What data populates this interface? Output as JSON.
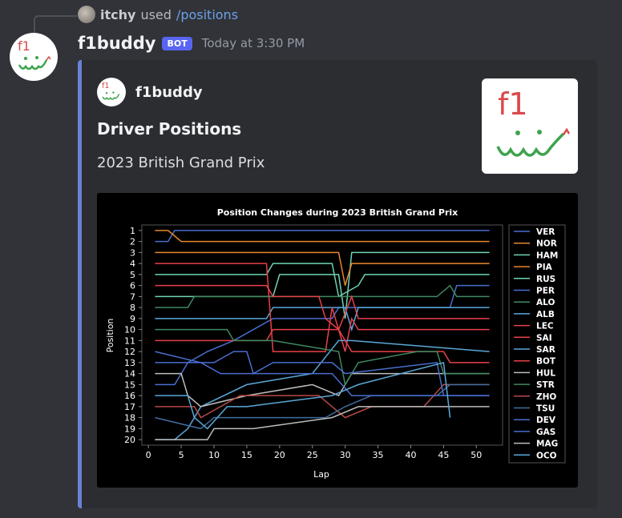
{
  "reply": {
    "user": "itchy",
    "used": "used",
    "command": "/positions"
  },
  "message": {
    "username": "f1buddy",
    "bot_tag": "BOT",
    "timestamp": "Today at 3:30 PM"
  },
  "embed": {
    "author": "f1buddy",
    "title": "Driver Positions",
    "description": "2023 British Grand Prix",
    "accent_color": "#6d7fd7",
    "thumbnail_text": "f1"
  },
  "chart_data": {
    "type": "line",
    "title": "Position Changes during 2023 British Grand Prix",
    "xlabel": "Lap",
    "ylabel": "Position",
    "xlim": [
      -1,
      54
    ],
    "ylim": [
      20.5,
      0.5
    ],
    "xticks": [
      0,
      5,
      10,
      15,
      20,
      25,
      30,
      35,
      40,
      45,
      50
    ],
    "yticks": [
      1,
      2,
      3,
      4,
      5,
      6,
      7,
      8,
      9,
      10,
      11,
      12,
      13,
      14,
      15,
      16,
      17,
      18,
      19,
      20
    ],
    "legend_placement": "right",
    "series": [
      {
        "name": "VER",
        "color": "#4a6ecf",
        "points": [
          [
            1,
            2
          ],
          [
            3,
            2
          ],
          [
            4,
            1
          ],
          [
            52,
            1
          ]
        ]
      },
      {
        "name": "NOR",
        "color": "#e8862a",
        "points": [
          [
            1,
            1
          ],
          [
            3,
            1
          ],
          [
            5,
            2
          ],
          [
            52,
            2
          ]
        ]
      },
      {
        "name": "HAM",
        "color": "#6fd3b4",
        "points": [
          [
            1,
            7
          ],
          [
            19,
            7
          ],
          [
            20,
            5
          ],
          [
            29,
            5
          ],
          [
            30,
            9
          ],
          [
            31,
            3
          ],
          [
            52,
            3
          ]
        ]
      },
      {
        "name": "PIA",
        "color": "#e8862a",
        "points": [
          [
            1,
            3
          ],
          [
            29,
            3
          ],
          [
            30,
            6
          ],
          [
            31,
            4
          ],
          [
            52,
            4
          ]
        ]
      },
      {
        "name": "RUS",
        "color": "#6fd3b4",
        "points": [
          [
            1,
            5
          ],
          [
            18,
            5
          ],
          [
            19,
            4
          ],
          [
            28,
            4
          ],
          [
            29,
            7
          ],
          [
            32,
            6
          ],
          [
            33,
            5
          ],
          [
            52,
            5
          ]
        ]
      },
      {
        "name": "PER",
        "color": "#4a6ecf",
        "points": [
          [
            1,
            15
          ],
          [
            4,
            15
          ],
          [
            6,
            13
          ],
          [
            9,
            12
          ],
          [
            13,
            11
          ],
          [
            19,
            9
          ],
          [
            28,
            9
          ],
          [
            29,
            8
          ],
          [
            46,
            8
          ],
          [
            47,
            6
          ],
          [
            52,
            6
          ]
        ]
      },
      {
        "name": "ALO",
        "color": "#3f8a5f",
        "points": [
          [
            1,
            8
          ],
          [
            6,
            8
          ],
          [
            7,
            7
          ],
          [
            44,
            7
          ],
          [
            46,
            6
          ],
          [
            47,
            7
          ],
          [
            52,
            7
          ]
        ]
      },
      {
        "name": "ALB",
        "color": "#5aa8d8",
        "points": [
          [
            1,
            9
          ],
          [
            18,
            9
          ],
          [
            19,
            8
          ],
          [
            30,
            8
          ],
          [
            31,
            10
          ],
          [
            32,
            8
          ],
          [
            52,
            8
          ]
        ]
      },
      {
        "name": "LEC",
        "color": "#e8404a",
        "points": [
          [
            1,
            6
          ],
          [
            18,
            6
          ],
          [
            19,
            7
          ],
          [
            26,
            7
          ],
          [
            27,
            9
          ],
          [
            29,
            10
          ],
          [
            31,
            7
          ],
          [
            32,
            9
          ],
          [
            52,
            9
          ]
        ]
      },
      {
        "name": "SAI",
        "color": "#e8404a",
        "points": [
          [
            1,
            4
          ],
          [
            18,
            4
          ],
          [
            19,
            12
          ],
          [
            27,
            12
          ],
          [
            28,
            8
          ],
          [
            30,
            12
          ],
          [
            31,
            9
          ],
          [
            32,
            10
          ],
          [
            42,
            10
          ],
          [
            43,
            10
          ],
          [
            52,
            10
          ]
        ]
      },
      {
        "name": "SAR",
        "color": "#5aa8d8",
        "points": [
          [
            1,
            20
          ],
          [
            4,
            20
          ],
          [
            6,
            19
          ],
          [
            8,
            17
          ],
          [
            15,
            15
          ],
          [
            25,
            14
          ],
          [
            29,
            11
          ],
          [
            31,
            11
          ],
          [
            52,
            12
          ]
        ]
      },
      {
        "name": "BOT",
        "color": "#e8404a",
        "points": [
          [
            1,
            11
          ],
          [
            18,
            11
          ],
          [
            19,
            10
          ],
          [
            29,
            10
          ],
          [
            30,
            11
          ],
          [
            31,
            12
          ],
          [
            45,
            12
          ],
          [
            46,
            13
          ],
          [
            52,
            13
          ]
        ]
      },
      {
        "name": "HUL",
        "color": "#bdbdbd",
        "points": [
          [
            1,
            14
          ],
          [
            5,
            14
          ],
          [
            6,
            16
          ],
          [
            8,
            17
          ],
          [
            15,
            16
          ],
          [
            25,
            15
          ],
          [
            29,
            16
          ],
          [
            31,
            14
          ],
          [
            52,
            14
          ]
        ]
      },
      {
        "name": "STR",
        "color": "#3f8a5f",
        "points": [
          [
            1,
            10
          ],
          [
            12,
            10
          ],
          [
            13,
            11
          ],
          [
            19,
            11
          ],
          [
            29,
            12
          ],
          [
            30,
            15
          ],
          [
            32,
            13
          ],
          [
            41,
            12
          ],
          [
            44,
            12
          ],
          [
            45,
            14
          ],
          [
            52,
            14
          ]
        ]
      },
      {
        "name": "ZHO",
        "color": "#b84a4a",
        "points": [
          [
            1,
            17
          ],
          [
            7,
            17
          ],
          [
            8,
            18
          ],
          [
            14,
            16
          ],
          [
            22,
            16
          ],
          [
            26,
            16
          ],
          [
            28,
            17
          ],
          [
            30,
            18
          ],
          [
            34,
            17
          ],
          [
            42,
            17
          ],
          [
            45,
            15
          ],
          [
            52,
            15
          ]
        ]
      },
      {
        "name": "TSU",
        "color": "#3f6ea0",
        "points": [
          [
            1,
            18
          ],
          [
            8,
            19
          ],
          [
            10,
            18
          ],
          [
            15,
            18
          ],
          [
            19,
            18
          ],
          [
            27,
            18
          ],
          [
            30,
            17
          ],
          [
            34,
            16
          ],
          [
            44,
            16
          ],
          [
            46,
            15
          ],
          [
            52,
            15
          ]
        ]
      },
      {
        "name": "DEV",
        "color": "#4a6ecf",
        "points": [
          [
            1,
            13
          ],
          [
            10,
            13
          ],
          [
            13,
            12
          ],
          [
            15,
            12
          ],
          [
            16,
            14
          ],
          [
            19,
            13
          ],
          [
            28,
            13
          ],
          [
            30,
            14
          ],
          [
            44,
            13
          ],
          [
            45,
            16
          ],
          [
            52,
            16
          ]
        ]
      },
      {
        "name": "GAS",
        "color": "#4a6ecf",
        "points": [
          [
            1,
            12
          ],
          [
            8,
            13
          ],
          [
            11,
            14
          ],
          [
            17,
            14
          ],
          [
            28,
            14
          ],
          [
            31,
            16
          ],
          [
            38,
            16
          ],
          [
            45,
            16
          ],
          [
            52,
            16
          ]
        ]
      },
      {
        "name": "MAG",
        "color": "#bdbdbd",
        "points": [
          [
            1,
            20
          ],
          [
            8,
            20
          ],
          [
            9,
            20
          ],
          [
            10,
            19
          ],
          [
            16,
            19
          ],
          [
            28,
            18
          ],
          [
            32,
            17
          ],
          [
            40,
            17
          ],
          [
            42,
            17
          ],
          [
            52,
            17
          ]
        ]
      },
      {
        "name": "OCO",
        "color": "#5aa8d8",
        "points": [
          [
            1,
            16
          ],
          [
            6,
            16
          ],
          [
            7,
            18
          ],
          [
            9,
            19
          ],
          [
            12,
            17
          ],
          [
            15,
            17
          ],
          [
            28,
            16
          ],
          [
            32,
            15
          ],
          [
            45,
            13
          ],
          [
            46,
            18
          ]
        ]
      }
    ]
  }
}
